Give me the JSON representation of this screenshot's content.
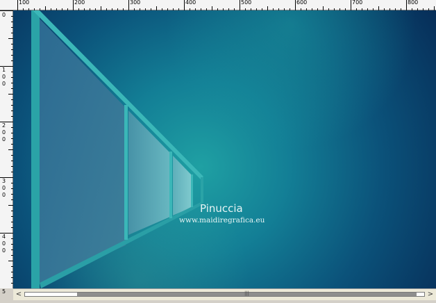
{
  "ruler": {
    "top_labels": [
      "100",
      "200",
      "300",
      "400",
      "500",
      "600",
      "700",
      "800"
    ],
    "left_labels": [
      [
        "0"
      ],
      [
        "1",
        "0",
        "0"
      ],
      [
        "2",
        "0",
        "0"
      ],
      [
        "3",
        "0",
        "0"
      ],
      [
        "4",
        "0",
        "0"
      ],
      [
        "5"
      ]
    ]
  },
  "watermark": {
    "name": "Pinuccia",
    "url": "www.maidiregrafica.eu"
  },
  "scrollbar": {
    "left_arrow": "<",
    "right_arrow": ">",
    "grip": "|||",
    "thumb_start_fraction": 0.13,
    "thumb_size_fraction": 0.85
  }
}
